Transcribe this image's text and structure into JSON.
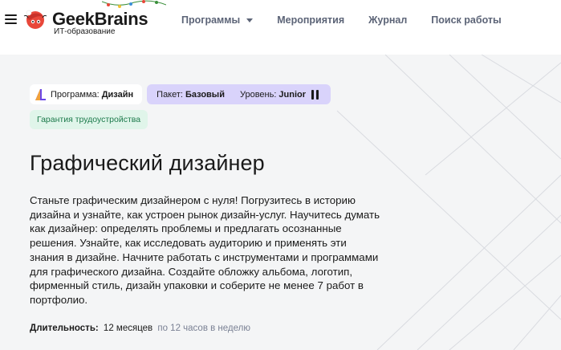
{
  "header": {
    "logo_name": "GeekBrains",
    "logo_subtitle": "ИТ-образование",
    "nav": {
      "programs": "Программы",
      "events": "Мероприятия",
      "journal": "Журнал",
      "jobs": "Поиск работы"
    }
  },
  "badges": {
    "program_label": "Программа:",
    "program_value": "Дизайн",
    "package_label": "Пакет:",
    "package_value": "Базовый",
    "level_label": "Уровень:",
    "level_value": "Junior",
    "guarantee": "Гарантия трудоустройства"
  },
  "course": {
    "title": "Графический дизайнер",
    "description": "Станьте графическим дизайнером с нуля! Погрузитесь в историю дизайна и узнайте, как устроен рынок дизайн-услуг. Научитесь думать как дизайнер: определять проблемы и предлагать осознанные решения. Узнайте, как исследовать аудиторию и применять эти знания в дизайне. Начните работать с инструментами и программами для графического дизайна. Создайте обложку альбома, логотип, фирменный стиль, дизайн упаковки и соберите не менее 7 работ в портфолио.",
    "duration_label": "Длительность:",
    "duration_value": "12 месяцев",
    "duration_hours": "по 12 часов в неделю"
  },
  "colors": {
    "nav_text": "#5c6477",
    "package_badge": "#d9d3fb",
    "guarantee_bg": "#e0f5ea",
    "guarantee_text": "#1c7a4b",
    "page_bg": "#f4f5f6"
  },
  "icons": [
    "menu-icon",
    "logo-mark-icon",
    "garland-icon",
    "chevron-down-icon",
    "design-program-icon",
    "level-bars-icon"
  ]
}
